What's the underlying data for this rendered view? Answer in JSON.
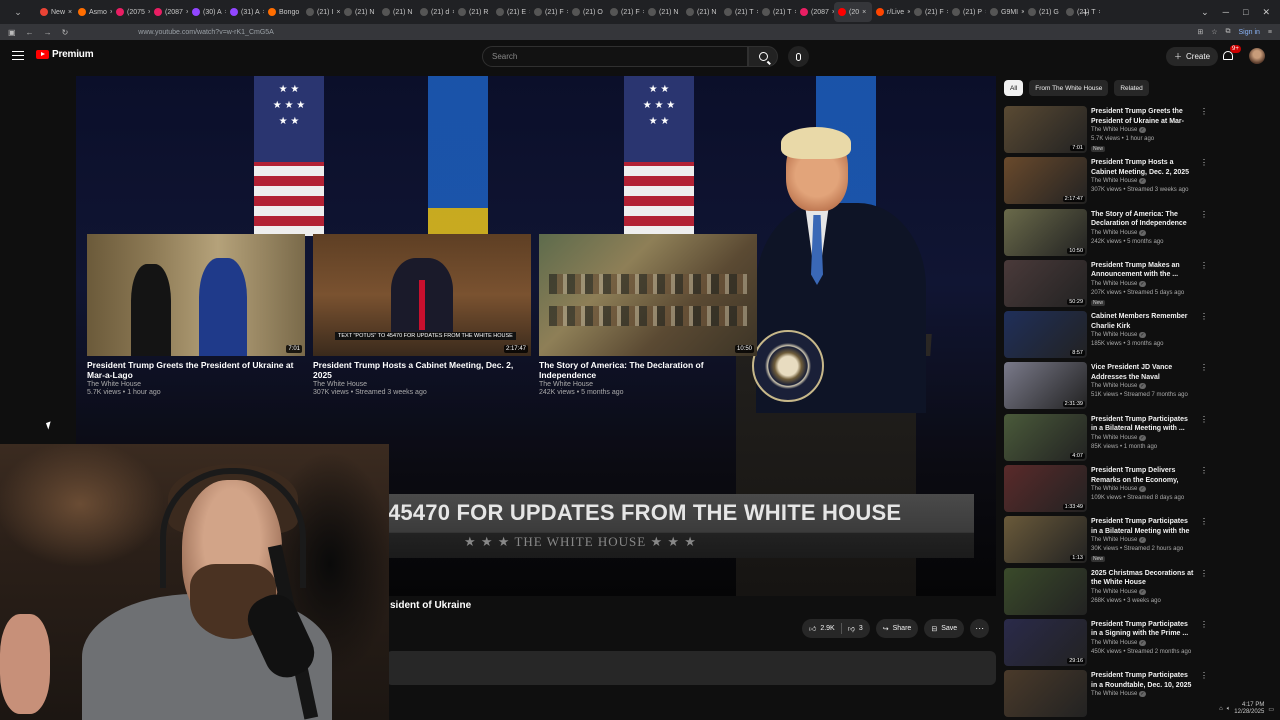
{
  "browser": {
    "tabs": [
      {
        "label": "New",
        "color": "#ea4335"
      },
      {
        "label": "Asmo",
        "color": "#ff6d00"
      },
      {
        "label": "(2075",
        "color": "#e91e63"
      },
      {
        "label": "(2087",
        "color": "#e91e63"
      },
      {
        "label": "(30) A",
        "color": "#9146ff"
      },
      {
        "label": "(31) A",
        "color": "#9146ff"
      },
      {
        "label": "Bongo",
        "color": "#ff6d00"
      },
      {
        "label": "(21) I",
        "color": "#555"
      },
      {
        "label": "(21) N",
        "color": "#555"
      },
      {
        "label": "(21) N",
        "color": "#555"
      },
      {
        "label": "(21) d",
        "color": "#555"
      },
      {
        "label": "(21) R",
        "color": "#555"
      },
      {
        "label": "(21) E",
        "color": "#555"
      },
      {
        "label": "(21) F",
        "color": "#555"
      },
      {
        "label": "(21) O",
        "color": "#555"
      },
      {
        "label": "(21) F",
        "color": "#555"
      },
      {
        "label": "(21) N",
        "color": "#555"
      },
      {
        "label": "(21) N",
        "color": "#555"
      },
      {
        "label": "(21) T",
        "color": "#555"
      },
      {
        "label": "(21) T",
        "color": "#555"
      },
      {
        "label": "(2087",
        "color": "#e91e63"
      },
      {
        "label": "(20",
        "color": "#ff0000",
        "active": true
      },
      {
        "label": "r/Live",
        "color": "#ff4500"
      },
      {
        "label": "(21) F",
        "color": "#555"
      },
      {
        "label": "(21) P",
        "color": "#555"
      },
      {
        "label": "G9MI",
        "color": "#555"
      },
      {
        "label": "(21) G",
        "color": "#555"
      },
      {
        "label": "(21) T",
        "color": "#555"
      }
    ],
    "url": "www.youtube.com/watch?v=w-rK1_CmG5A",
    "sign_in": "Sign in"
  },
  "youtube": {
    "brand": "Premium",
    "search_placeholder": "Search",
    "create_label": "Create",
    "notification_count": "9+"
  },
  "player": {
    "banner_text": "45470 FOR UPDATES FROM THE WHITE HOUSE",
    "banner_sub": "★ ★ ★   THE WHITE HOUSE   ★ ★ ★",
    "endscreen": [
      {
        "title": "President Trump Greets the President of Ukraine at Mar-a-Lago",
        "channel": "The White House",
        "meta": "5.7K views • 1 hour ago",
        "duration": "7:01"
      },
      {
        "title": "President Trump Hosts a Cabinet Meeting, Dec. 2, 2025",
        "channel": "The White House",
        "meta": "307K views • Streamed 3 weeks ago",
        "duration": "2:17:47",
        "strip": "TEXT \"POTUS\" TO 45470 FOR UPDATES FROM THE WHITE HOUSE"
      },
      {
        "title": "The Story of America: The Declaration of Independence",
        "channel": "The White House",
        "meta": "242K views • 5 months ago",
        "duration": "10:50"
      }
    ]
  },
  "below_video": {
    "title_fragment": "sident of Ukraine",
    "likes": "2.9K",
    "dislikes": "3",
    "share_label": "Share",
    "save_label": "Save"
  },
  "sidebar": {
    "chips": [
      "All",
      "From The White House",
      "Related"
    ],
    "recommendations": [
      {
        "title": "President Trump Greets the President of Ukraine at Mar-a-...",
        "channel": "The White House",
        "meta": "5.7K views • 1 hour ago",
        "duration": "7:01",
        "is_new": true,
        "thumb_color": "#5a4a33"
      },
      {
        "title": "President Trump Hosts a Cabinet Meeting, Dec. 2, 2025",
        "channel": "The White House",
        "meta": "307K views • Streamed 3 weeks ago",
        "duration": "2:17:47",
        "is_new": false,
        "thumb_color": "#6a4a2c"
      },
      {
        "title": "The Story of America: The Declaration of Independence",
        "channel": "The White House",
        "meta": "242K views • 5 months ago",
        "duration": "10:50",
        "is_new": false,
        "thumb_color": "#6a6a4a"
      },
      {
        "title": "President Trump Makes an Announcement with the ...",
        "channel": "The White House",
        "meta": "207K views • Streamed 5 days ago",
        "duration": "50:29",
        "is_new": true,
        "thumb_color": "#4a3a3a"
      },
      {
        "title": "Cabinet Members Remember Charlie Kirk",
        "channel": "The White House",
        "meta": "185K views • 3 months ago",
        "duration": "8:57",
        "is_new": false,
        "thumb_color": "#1f2f5a"
      },
      {
        "title": "Vice President JD Vance Addresses the Naval Academy...",
        "channel": "The White House",
        "meta": "51K views • Streamed 7 months ago",
        "duration": "2:31:39",
        "is_new": false,
        "thumb_color": "#7a7a8a"
      },
      {
        "title": "President Trump Participates in a Bilateral Meeting with ...",
        "channel": "The White House",
        "meta": "85K views • 1 month ago",
        "duration": "4:07",
        "is_new": false,
        "thumb_color": "#4a5a3a"
      },
      {
        "title": "President Trump Delivers Remarks on the Economy, Dec...",
        "channel": "The White House",
        "meta": "109K views • Streamed 8 days ago",
        "duration": "1:33:49",
        "is_new": false,
        "thumb_color": "#5a2a2a"
      },
      {
        "title": "President Trump Participates in a Bilateral Meeting with the ...",
        "channel": "The White House",
        "meta": "30K views • Streamed 2 hours ago",
        "duration": "1:13",
        "is_new": true,
        "thumb_color": "#6a5a3a"
      },
      {
        "title": "2025 Christmas Decorations at the White House",
        "channel": "The White House",
        "meta": "268K views • 3 weeks ago",
        "duration": "",
        "is_new": false,
        "thumb_color": "#3a4a2a"
      },
      {
        "title": "President Trump Participates in a Signing with the Prime ...",
        "channel": "The White House",
        "meta": "450K views • Streamed 2 months ago",
        "duration": "29:16",
        "is_new": false,
        "thumb_color": "#2a2a4a"
      },
      {
        "title": "President Trump Participates in a Roundtable, Dec. 10, 2025",
        "channel": "The White House",
        "meta": "",
        "duration": "",
        "is_new": false,
        "thumb_color": "#4a3a2a"
      }
    ]
  },
  "system": {
    "time": "4:17 PM",
    "date": "12/28/2025"
  }
}
